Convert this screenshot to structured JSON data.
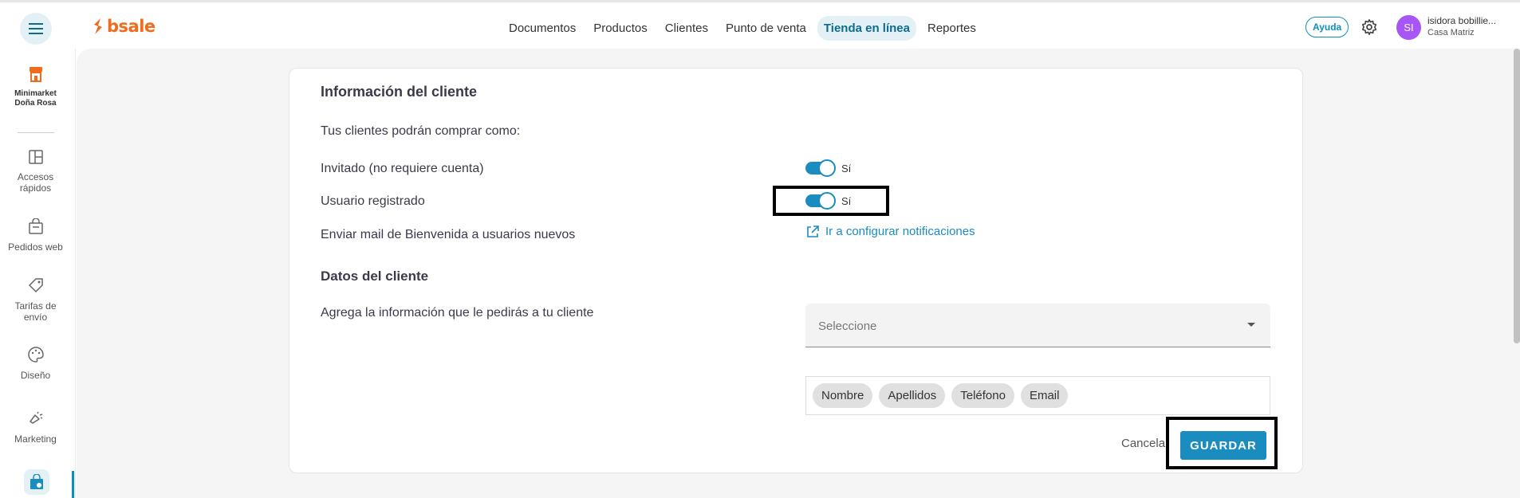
{
  "header": {
    "brand": "bsale",
    "nav": [
      "Documentos",
      "Productos",
      "Clientes",
      "Punto de venta",
      "Tienda en línea",
      "Reportes"
    ],
    "active_nav": "Tienda en línea",
    "help_label": "Ayuda",
    "avatar_initials": "SI",
    "user_name": "isidora bobillie...",
    "user_branch": "Casa Matriz"
  },
  "sidebar": {
    "store_name_line1": "Minimarket",
    "store_name_line2": "Doña Rosa",
    "items": [
      {
        "line1": "Accesos",
        "line2": "rápidos"
      },
      {
        "line1": "Pedidos web",
        "line2": ""
      },
      {
        "line1": "Tarifas de",
        "line2": "envío"
      },
      {
        "line1": "Diseño",
        "line2": ""
      },
      {
        "line1": "Marketing",
        "line2": ""
      }
    ]
  },
  "form": {
    "title": "Información del cliente",
    "intro": "Tus clientes podrán comprar como:",
    "guest_label": "Invitado (no requiere cuenta)",
    "guest_toggle": "Sí",
    "registered_label": "Usuario registrado",
    "registered_toggle": "Sí",
    "welcome_mail_label": "Enviar mail de Bienvenida a usuarios nuevos",
    "notifications_link": "Ir a configurar notificaciones",
    "client_data_title": "Datos del cliente",
    "client_data_desc": "Agrega la información que le pedirás a tu cliente",
    "select_placeholder": "Seleccione",
    "chips": [
      "Nombre",
      "Apellidos",
      "Teléfono",
      "Email"
    ],
    "cancel_label": "Cancelar",
    "save_label": "GUARDAR"
  },
  "colors": {
    "accent": "#1a8cc0",
    "brand": "#f26b1d",
    "avatar": "#a855f7"
  }
}
